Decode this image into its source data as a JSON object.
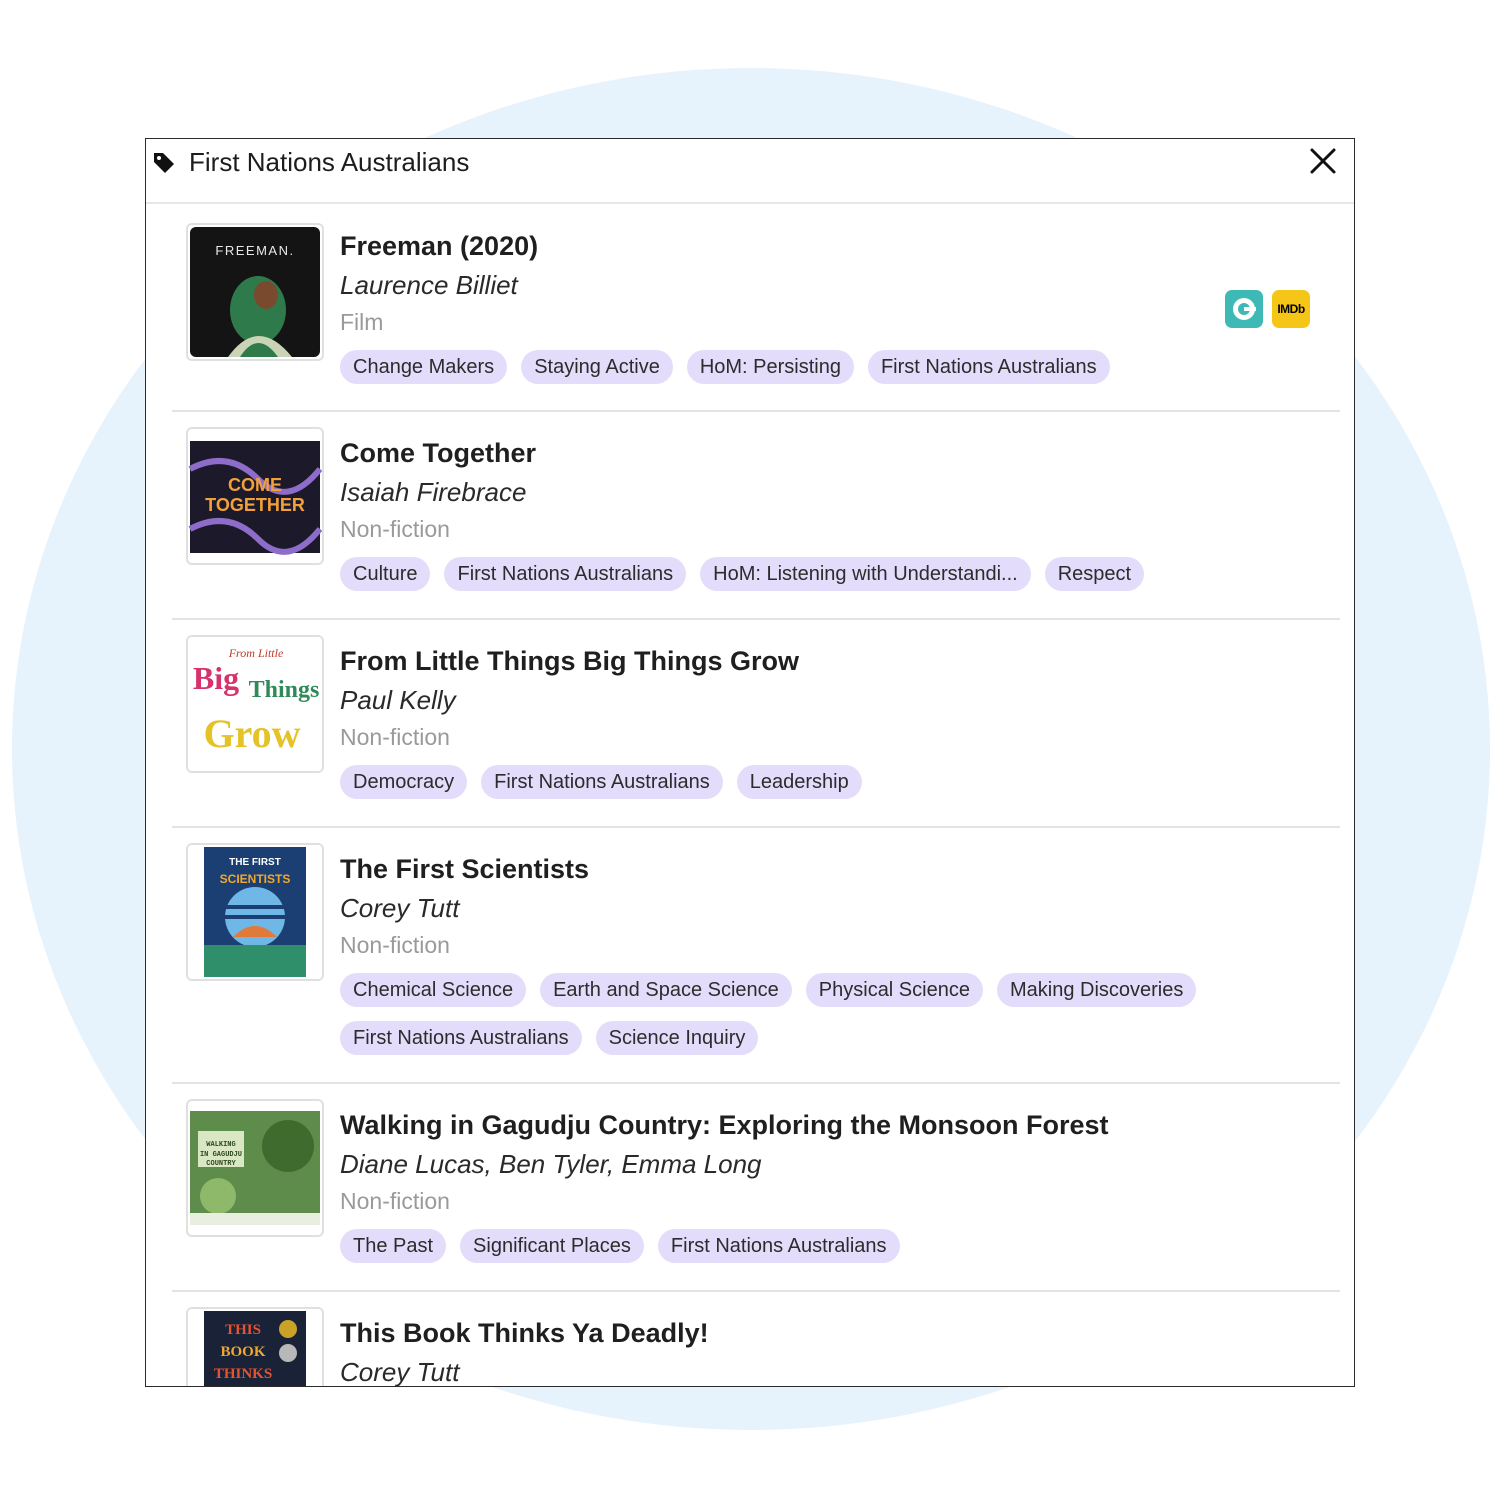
{
  "modal": {
    "title": "First Nations Australians",
    "icons": {
      "tag": "tag-icon",
      "close": "close-icon"
    }
  },
  "colors": {
    "tag_bg": "#e4dcfb",
    "background_blob": "#e6f2fc",
    "clickview": "#3dbab6",
    "imdb": "#f5c518"
  },
  "items": [
    {
      "title": "Freeman (2020)",
      "author": "Laurence Billiet",
      "type": "Film",
      "cover_text": "FREEMAN.",
      "external_links": {
        "imdb_label": "IMDb",
        "clickview_icon": "clickview-icon"
      },
      "tags": [
        "Change Makers",
        "Staying Active",
        "HoM: Persisting",
        "First Nations Australians"
      ]
    },
    {
      "title": "Come Together",
      "author": "Isaiah Firebrace",
      "type": "Non-fiction",
      "cover_text": "COME TOGETHER",
      "tags": [
        "Culture",
        "First Nations Australians",
        "HoM: Listening with Understandi...",
        "Respect"
      ]
    },
    {
      "title": "From Little Things Big Things Grow",
      "author": "Paul Kelly",
      "type": "Non-fiction",
      "cover_text": "Big Things Grow",
      "tags": [
        "Democracy",
        "First Nations Australians",
        "Leadership"
      ]
    },
    {
      "title": "The First Scientists",
      "author": "Corey Tutt",
      "type": "Non-fiction",
      "cover_text": "THE FIRST SCIENTISTS",
      "tags": [
        "Chemical Science",
        "Earth and Space Science",
        "Physical Science",
        "Making Discoveries",
        "First Nations Australians",
        "Science Inquiry"
      ]
    },
    {
      "title": "Walking in Gagudju Country: Exploring the Monsoon Forest",
      "author": "Diane Lucas, Ben Tyler, Emma Long",
      "type": "Non-fiction",
      "cover_text": "WALKING IN GAGUDJU COUNTRY",
      "tags": [
        "The Past",
        "Significant Places",
        "First Nations Australians"
      ]
    },
    {
      "title": "This Book Thinks Ya Deadly!",
      "author": "Corey Tutt",
      "type": "",
      "cover_text": "THIS BOOK THINKS YA",
      "tags": []
    }
  ]
}
